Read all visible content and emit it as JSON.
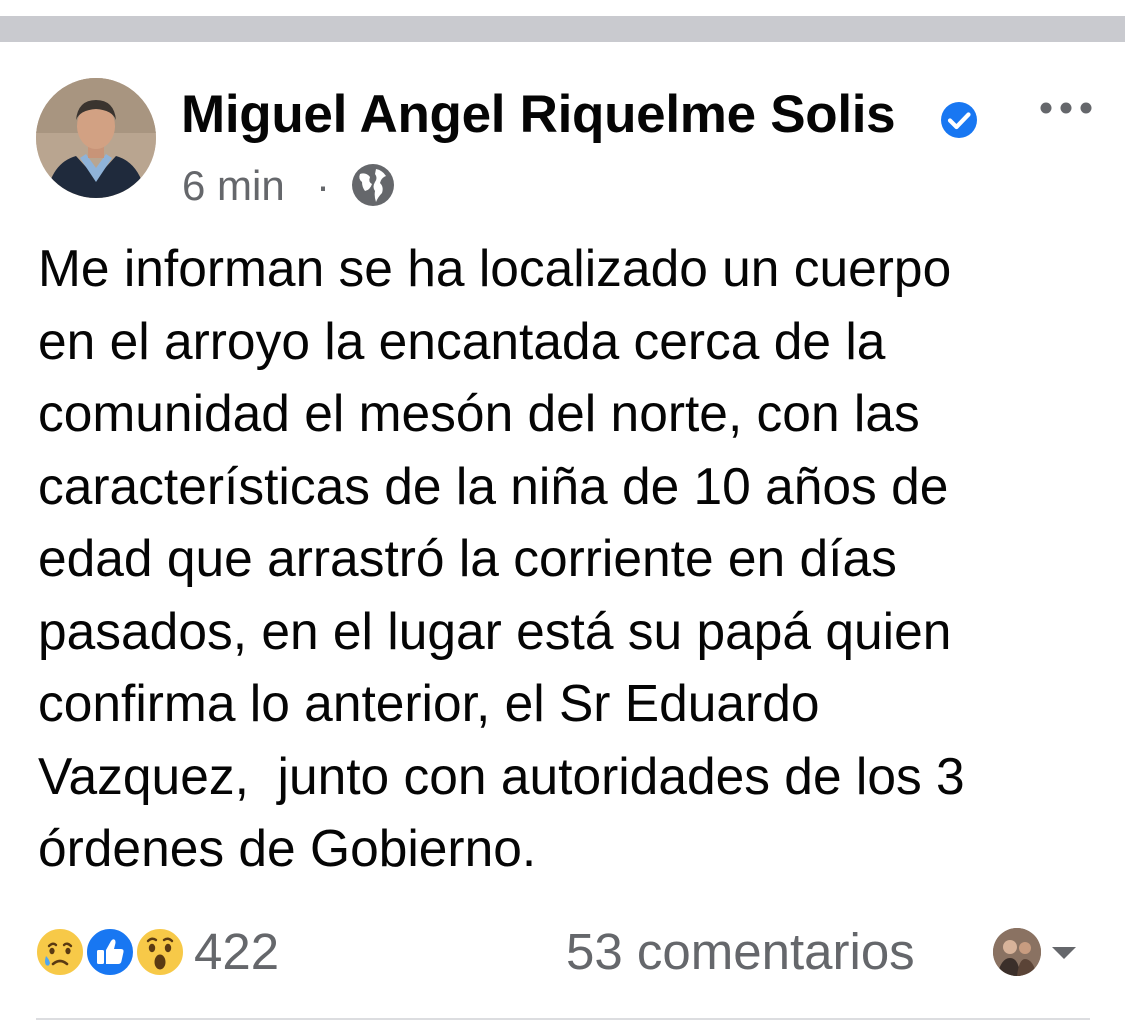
{
  "post": {
    "author": {
      "name": "Miguel Angel Riquelme Solis",
      "verified": true,
      "avatar_icon": "profile-photo"
    },
    "meta": {
      "time": "6 min",
      "separator": "·",
      "audience_icon": "globe-icon"
    },
    "more_icon": "more-horizontal-icon",
    "text": "Me informan se ha localizado un cuerpo\nen el arroyo la encantada cerca de la\ncomunidad el mesón del norte, con las\ncaracterísticas de la niña de 10 años de\nedad que arrastró la corriente en días\npasados, en el lugar está su papá quien\nconfirma lo anterior, el Sr Eduardo\nVazquez,  junto con autoridades de los 3\nórdenes de Gobierno.",
    "reactions": {
      "icons": [
        "sad-reaction-icon",
        "like-reaction-icon",
        "wow-reaction-icon"
      ],
      "count": "422"
    },
    "comments": {
      "label": "53 comentarios"
    }
  },
  "colors": {
    "primary_text": "#050505",
    "secondary_text": "#65676b",
    "verified_blue": "#1877f2",
    "top_band": "#c9cacf",
    "divider": "#dcdde0"
  }
}
